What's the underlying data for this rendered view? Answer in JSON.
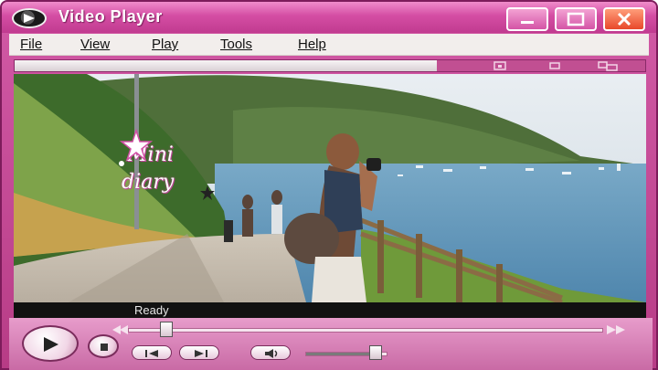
{
  "window": {
    "title": "Video Player"
  },
  "menu": {
    "items": [
      {
        "label": "File"
      },
      {
        "label": "View"
      },
      {
        "label": "Play"
      },
      {
        "label": "Tools"
      },
      {
        "label": "Help"
      }
    ]
  },
  "video": {
    "overlay_line1": "Mini",
    "overlay_line2": "diary"
  },
  "status": {
    "text": "Ready"
  },
  "playback": {
    "position_fraction": 0.08,
    "buffer_fraction": 0.67,
    "volume_fraction": 0.85
  },
  "colors": {
    "titlebar": "#d44da3",
    "close_button": "#e8482a",
    "controls_bg": "#e79ccb"
  },
  "icons": {
    "app": "film-reel-icon",
    "play": "play-icon",
    "stop": "stop-icon",
    "prev": "skip-back-icon",
    "next": "skip-forward-icon",
    "mute": "speaker-icon"
  }
}
